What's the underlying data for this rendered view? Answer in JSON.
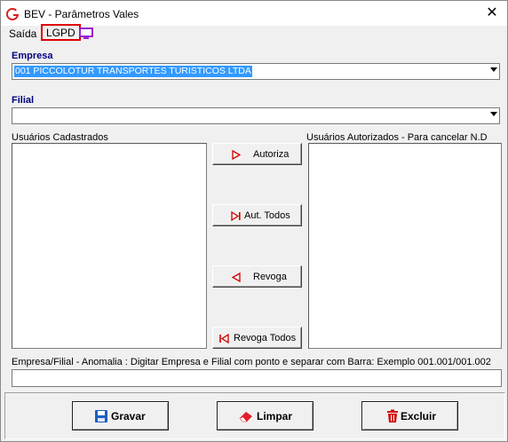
{
  "window": {
    "title": "BEV - Parâmetros Vales",
    "close_glyph": "✕"
  },
  "menu": {
    "saida": "Saída",
    "lgpd": "LGPD",
    "monitor_icon": "monitor-icon"
  },
  "empresa": {
    "label": "Empresa",
    "value": "001 PICCOLOTUR TRANSPORTES TURISTICOS LTDA"
  },
  "filial": {
    "label": "Filial",
    "value": ""
  },
  "lists": {
    "cadastrados_label": "Usuários Cadastrados",
    "autorizados_label": "Usuários Autorizados - Para cancelar N.D"
  },
  "transfer_buttons": {
    "autoriza": "Autoriza",
    "aut_todos": "Aut. Todos",
    "revoga": "Revoga",
    "revoga_todos": "Revoga Todos"
  },
  "anomalia": {
    "label": "Empresa/Filial - Anomalia :  Digitar Empresa e Filial com ponto e separar com Barra: Exemplo 001.001/001.002",
    "value": ""
  },
  "actions": {
    "gravar": "Gravar",
    "limpar": "Limpar",
    "excluir": "Excluir"
  },
  "colors": {
    "accent_label": "#00007f",
    "selection": "#3399ff",
    "highlight_border": "#e00000",
    "arrow_red": "#d00000"
  }
}
